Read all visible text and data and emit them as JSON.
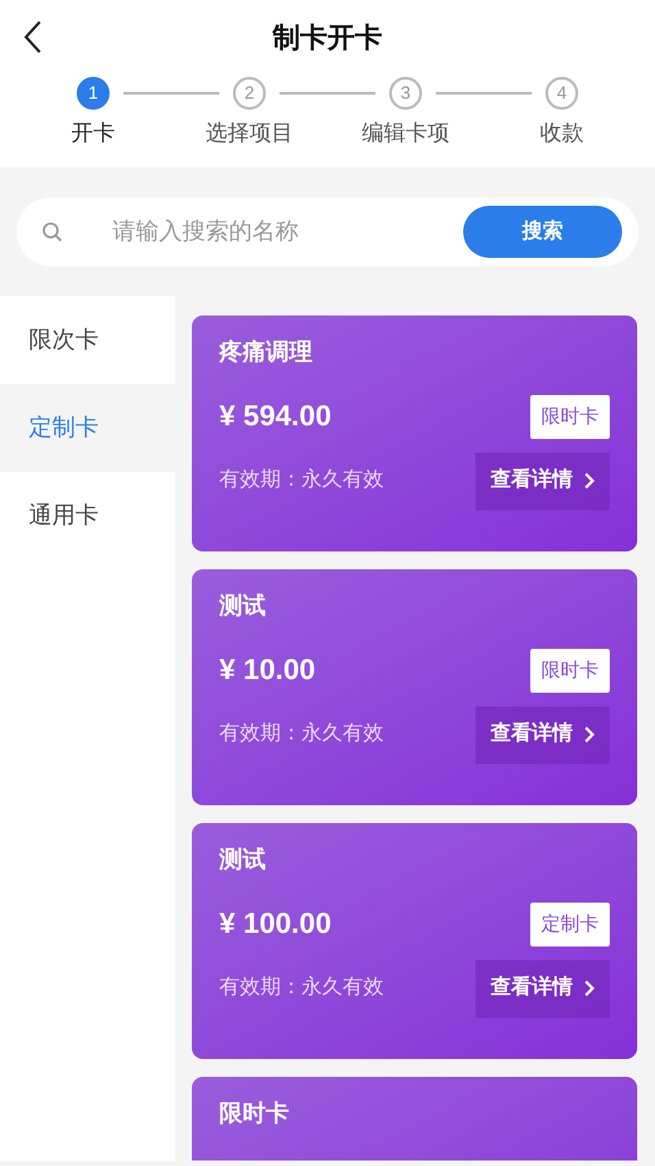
{
  "header": {
    "title": "制卡开卡"
  },
  "steps": [
    {
      "number": "1",
      "label": "开卡",
      "selected": true
    },
    {
      "number": "2",
      "label": "选择项目",
      "selected": false
    },
    {
      "number": "3",
      "label": "编辑卡项",
      "selected": false
    },
    {
      "number": "4",
      "label": "收款",
      "selected": false
    }
  ],
  "search": {
    "placeholder": "请输入搜索的名称",
    "button": "搜索"
  },
  "sidebar": {
    "items": [
      {
        "label": "限次卡",
        "selected": false
      },
      {
        "label": "定制卡",
        "selected": true
      },
      {
        "label": "通用卡",
        "selected": false
      }
    ]
  },
  "cards": [
    {
      "name": "疼痛调理",
      "price": "¥ 594.00",
      "tag": "限时卡",
      "validity": "有效期：永久有效",
      "detail": "查看详情"
    },
    {
      "name": "测试",
      "price": "¥ 10.00",
      "tag": "限时卡",
      "validity": "有效期：永久有效",
      "detail": "查看详情"
    },
    {
      "name": "测试",
      "price": "¥ 100.00",
      "tag": "定制卡",
      "validity": "有效期：永久有效",
      "detail": "查看详情"
    },
    {
      "name": "限时卡"
    }
  ]
}
